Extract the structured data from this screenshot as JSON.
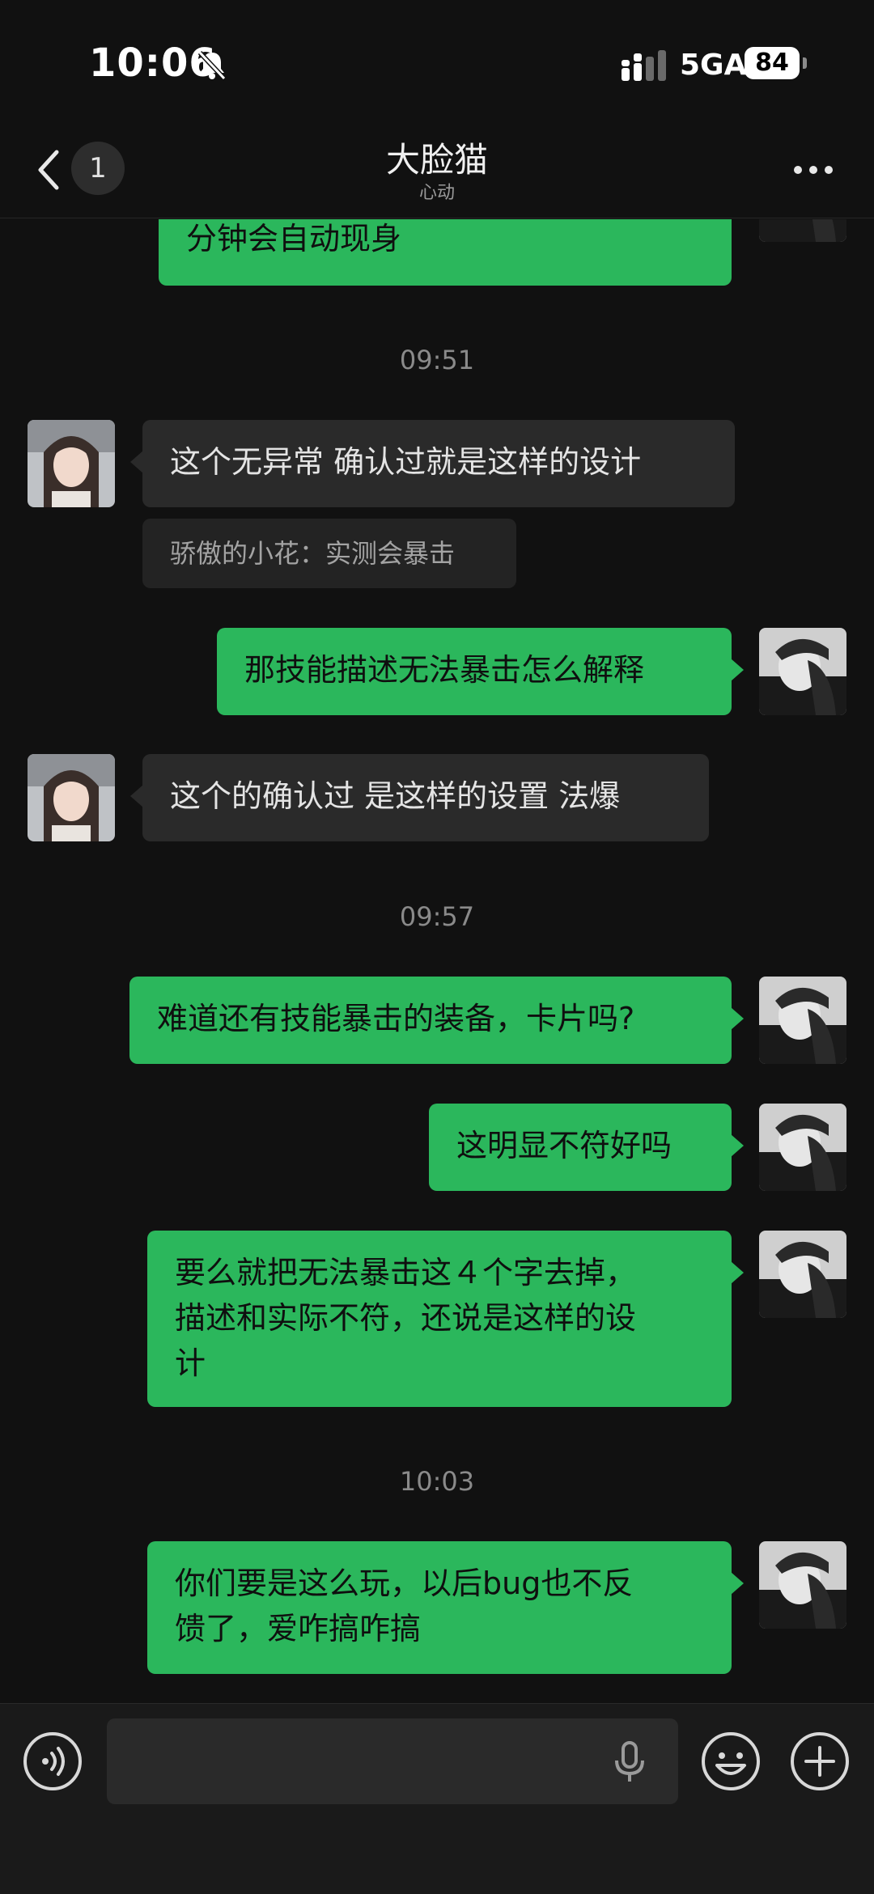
{
  "status_bar": {
    "time": "10:06",
    "network": "5GA",
    "battery": "84"
  },
  "header": {
    "back_count": "1",
    "title": "大脸猫",
    "subtitle": "心动"
  },
  "messages": [
    {
      "kind": "outgoing",
      "text": "分钟会自动现身"
    },
    {
      "kind": "timestamp",
      "text": "09:51"
    },
    {
      "kind": "incoming",
      "text": "这个无异常 确认过就是这样的设计"
    },
    {
      "kind": "quote",
      "text": "骄傲的小花：实测会暴击"
    },
    {
      "kind": "outgoing",
      "text": "那技能描述无法暴击怎么解释"
    },
    {
      "kind": "incoming",
      "text": "这个的确认过 是这样的设置 法爆"
    },
    {
      "kind": "timestamp",
      "text": "09:57"
    },
    {
      "kind": "outgoing",
      "text": "难道还有技能暴击的装备，卡片吗?"
    },
    {
      "kind": "outgoing",
      "text": "这明显不符好吗"
    },
    {
      "kind": "outgoing",
      "line1": "要么就把无法暴击这４个字去掉，",
      "line2": "描述和实际不符，还说是这样的设",
      "line3": "计"
    },
    {
      "kind": "timestamp",
      "text": "10:03"
    },
    {
      "kind": "outgoing",
      "line1": "你们要是这么玩，以后bug也不反",
      "line2": "馈了，爱咋搞咋搞"
    }
  ],
  "input": {
    "value": ""
  },
  "colors": {
    "background": "#111111",
    "outgoing_bubble": "#2bb75c",
    "incoming_bubble": "#2a2a2a",
    "input_bar": "#1a1a1a"
  },
  "icons": [
    "bell-muted-icon",
    "signal-icon",
    "back-chevron-icon",
    "more-dots-icon",
    "voice-icon",
    "microphone-icon",
    "emoji-icon",
    "plus-icon"
  ]
}
